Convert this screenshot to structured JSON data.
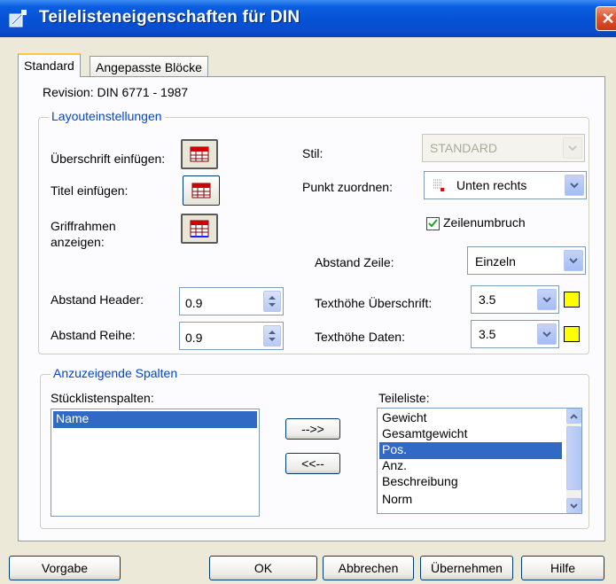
{
  "window": {
    "title": "Teilelisteneigenschaften für DIN",
    "close_glyph": "✕"
  },
  "tabs": [
    {
      "label": "Standard",
      "active": true
    },
    {
      "label": "Angepasste Blöcke",
      "active": false
    }
  ],
  "revision": "Revision: DIN 6771 - 1987",
  "layout": {
    "legend": "Layouteinstellungen",
    "header_insert_label": "Überschrift einfügen:",
    "title_insert_label": "Titel einfügen:",
    "grip_label_line1": "Griffrahmen",
    "grip_label_line2": "anzeigen:",
    "style_label": "Stil:",
    "style_value": "STANDARD",
    "point_label": "Punkt zuordnen:",
    "point_value": "Unten rechts",
    "wrap_label": "Zeilenumbruch",
    "wrap_checked": true,
    "line_spacing_label": "Abstand Zeile:",
    "line_spacing_value": "Einzeln",
    "header_spacing_label": "Abstand Header:",
    "header_spacing_value": "0.9",
    "row_spacing_label": "Abstand Reihe:",
    "row_spacing_value": "0.9",
    "header_text_height_label": "Texthöhe Überschrift:",
    "header_text_height_value": "3.5",
    "data_text_height_label": "Texthöhe Daten:",
    "data_text_height_value": "3.5",
    "swatch_color": "#ffff00"
  },
  "columns": {
    "legend": "Anzuzeigende Spalten",
    "bom_label": "Stücklistenspalten:",
    "bom_items": [
      "Name"
    ],
    "parts_label": "Teileliste:",
    "parts_items": [
      "Gewicht",
      "Gesamtgewicht",
      "Pos.",
      "Anz.",
      "Beschreibung",
      "Norm"
    ],
    "parts_selected_index": 2,
    "add_button": "-->>",
    "remove_button": "<<--"
  },
  "buttons": {
    "default": "Vorgabe",
    "ok": "OK",
    "cancel": "Abbrechen",
    "apply": "Übernehmen",
    "help": "Hilfe"
  },
  "colors": {
    "selection": "#316ac5",
    "accent": "#0046d5",
    "titlebar": "#0551d6"
  }
}
